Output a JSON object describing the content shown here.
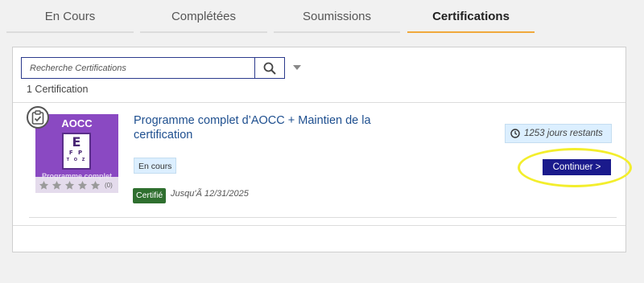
{
  "tabs": [
    {
      "label": "En Cours",
      "active": false
    },
    {
      "label": "Complétées",
      "active": false
    },
    {
      "label": "Soumissions",
      "active": false
    },
    {
      "label": "Certifications",
      "active": true
    }
  ],
  "search": {
    "placeholder": "Recherche Certifications",
    "value": "",
    "icon": "search-icon"
  },
  "result_count": "1 Certification",
  "item": {
    "thumbnail": {
      "title": "AOCC",
      "chart_lines": [
        "E",
        "F P",
        "T O Z"
      ],
      "subtitle": "Programme complet",
      "rating_count": "(0)",
      "stars_filled": 0,
      "stars_total": 5
    },
    "badge_icon": "clipboard-check-icon",
    "title": "Programme complet d’AOCC + Maintien de la certification",
    "status": "En cours",
    "certified_label": "Certifié",
    "until": "Jusqu'Ã  12/31/2025",
    "days_remaining": "1253 jours restants",
    "continue_label": "Continuer >"
  },
  "colors": {
    "accent_tab": "#f0a93b",
    "title_link": "#1e4f8f",
    "continue_button": "#1a1a8c",
    "certified": "#2f6f2f",
    "thumbnail": "#8a49c2",
    "highlight": "#f3ee2c"
  }
}
